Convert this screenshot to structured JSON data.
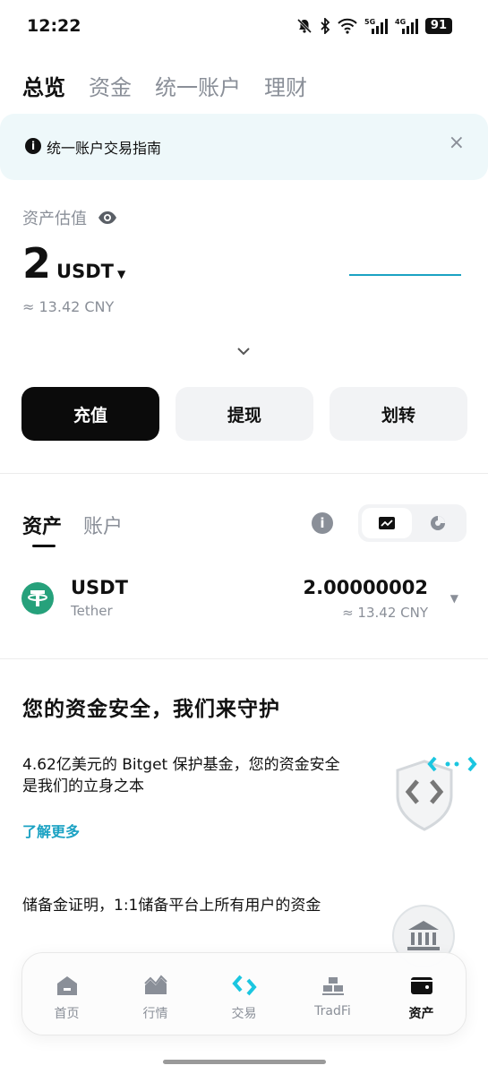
{
  "status_bar": {
    "time": "12:22",
    "battery": "91",
    "network_5g": "5G",
    "network_4g": "4G"
  },
  "top_tabs": [
    {
      "label": "总览",
      "active": true
    },
    {
      "label": "资金",
      "active": false
    },
    {
      "label": "统一账户",
      "active": false
    },
    {
      "label": "理财",
      "active": false
    }
  ],
  "banner": {
    "text": "统一账户交易指南",
    "info_icon": "i",
    "close_icon": "×"
  },
  "assets": {
    "label": "资产估值",
    "value": "2",
    "unit": "USDT",
    "cny": "≈ 13.42 CNY"
  },
  "actions": {
    "deposit": "充值",
    "withdraw": "提现",
    "transfer": "划转"
  },
  "asset_tabs": [
    {
      "label": "资产",
      "active": true
    },
    {
      "label": "账户",
      "active": false
    }
  ],
  "info_button": "i",
  "asset_list": [
    {
      "symbol": "USDT",
      "name": "Tether",
      "amount": "2.00000002",
      "cny": "≈ 13.42 CNY"
    }
  ],
  "security": {
    "title": "您的资金安全，我们来守护",
    "fund_text": "4.62亿美元的 Bitget 保护基金，您的资金安全是我们的立身之本",
    "learn_more": "了解更多",
    "reserve_text": "储备金证明，1:1储备平台上所有用户的资金"
  },
  "bottom_nav": [
    {
      "label": "首页",
      "icon": "home-icon",
      "active": false
    },
    {
      "label": "行情",
      "icon": "market-chart-icon",
      "active": false
    },
    {
      "label": "交易",
      "icon": "trade-logo-icon",
      "active": false
    },
    {
      "label": "TradFi",
      "icon": "gold-bars-icon",
      "active": false
    },
    {
      "label": "资产",
      "icon": "wallet-icon",
      "active": true
    }
  ],
  "colors": {
    "accent": "#1ba2c3",
    "tether": "#26a17b",
    "muted": "#8a8f98",
    "banner_bg": "#eef8fa"
  }
}
